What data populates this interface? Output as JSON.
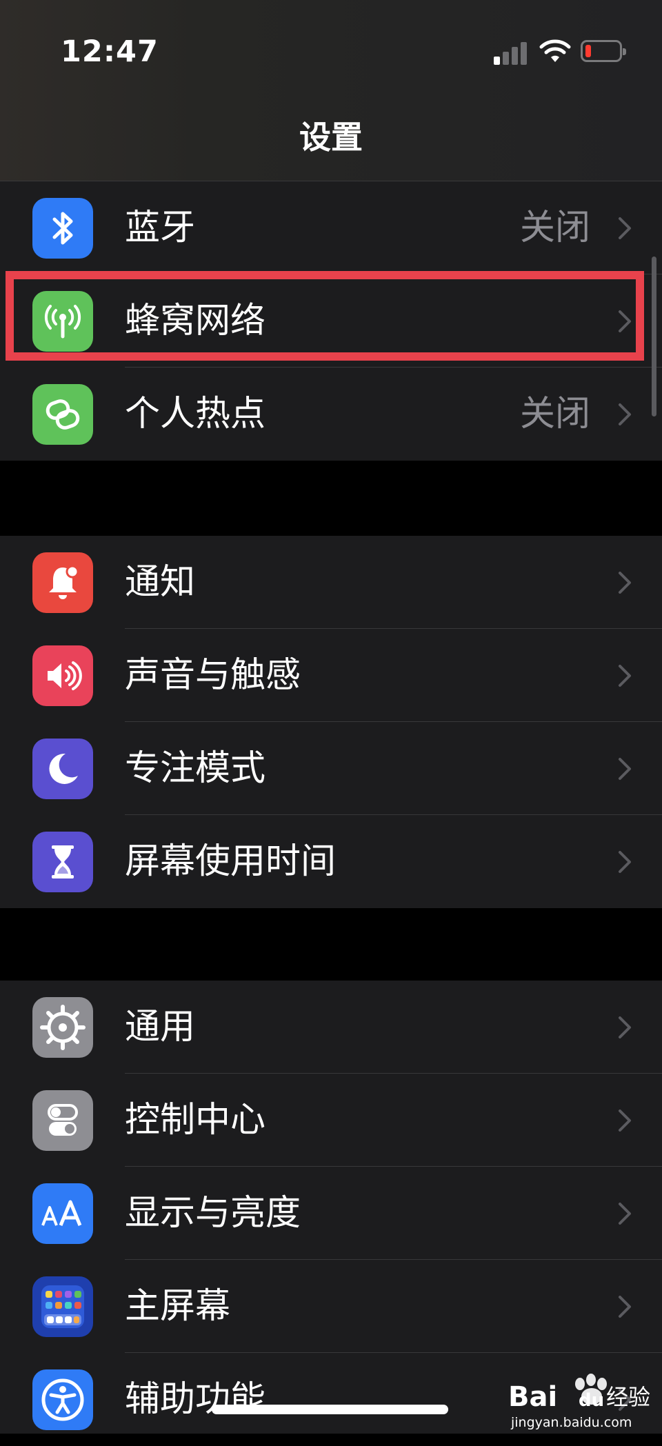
{
  "status_bar": {
    "time": "12:47"
  },
  "nav": {
    "title": "设置"
  },
  "groups": [
    {
      "items": [
        {
          "label": "蓝牙",
          "value": "关闭",
          "icon": "bluetooth-icon",
          "color": "#2f7bf6"
        },
        {
          "label": "蜂窝网络",
          "value": "",
          "icon": "cellular-antenna-icon",
          "color": "#5fc25a"
        },
        {
          "label": "个人热点",
          "value": "关闭",
          "icon": "hotspot-link-icon",
          "color": "#5fc25a"
        }
      ]
    },
    {
      "items": [
        {
          "label": "通知",
          "icon": "notification-bell-icon",
          "color": "#e9483e"
        },
        {
          "label": "声音与触感",
          "icon": "speaker-icon",
          "color": "#e9435a"
        },
        {
          "label": "专注模式",
          "icon": "moon-icon",
          "color": "#5a4fd0"
        },
        {
          "label": "屏幕使用时间",
          "icon": "hourglass-icon",
          "color": "#5a4fd0"
        }
      ]
    },
    {
      "items": [
        {
          "label": "通用",
          "icon": "gear-icon",
          "color": "#8e8e93"
        },
        {
          "label": "控制中心",
          "icon": "toggle-switches-icon",
          "color": "#8e8e93"
        },
        {
          "label": "显示与亮度",
          "icon": "text-size-icon",
          "color": "#2f7bf6"
        },
        {
          "label": "主屏幕",
          "icon": "home-screen-grid-icon",
          "color": "#2f5bd8"
        },
        {
          "label": "辅助功能",
          "icon": "accessibility-icon",
          "color": "#2f7bf6"
        }
      ]
    }
  ],
  "highlight_color": "#e8424c",
  "watermark": {
    "brand": "Bai",
    "brand2": "du",
    "suffix": "经验",
    "url": "jingyan.baidu.com"
  }
}
